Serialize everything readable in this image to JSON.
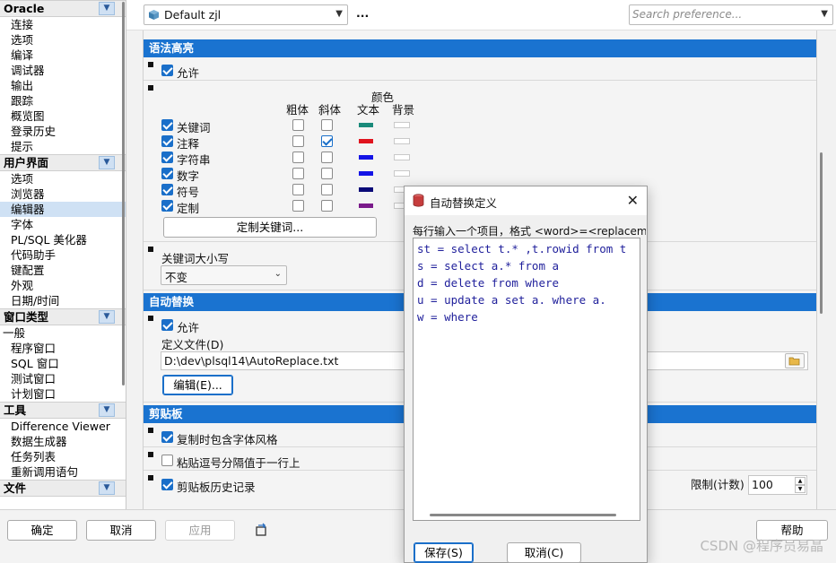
{
  "sidebar": {
    "groups": [
      {
        "header": "Oracle",
        "items": [
          "连接",
          "选项",
          "编译",
          "调试器",
          "输出",
          "跟踪",
          "概览图",
          "登录历史",
          "提示"
        ]
      },
      {
        "header": "用户界面",
        "items": [
          "选项",
          "浏览器",
          "编辑器",
          "字体",
          "PL/SQL 美化器",
          "代码助手",
          "键配置",
          "外观",
          "日期/时间"
        ],
        "selected": 2
      },
      {
        "header": "窗口类型",
        "items": [
          "一般",
          "程序窗口",
          "SQL 窗口",
          "测试窗口",
          "计划窗口"
        ],
        "flush_first": true
      },
      {
        "header": "工具",
        "items": [
          "Difference Viewer",
          "数据生成器",
          "任务列表",
          "重新调用语句"
        ]
      },
      {
        "header": "文件",
        "items": []
      }
    ]
  },
  "topbar": {
    "profile_value": "Default zjl",
    "more_label": "...",
    "search_placeholder": "Search preference..."
  },
  "syntax": {
    "header": "语法高亮",
    "enable_label": "允许",
    "col_bold": "粗体",
    "col_italic": "斜体",
    "col_color": "颜色",
    "col_text": "文本",
    "col_bg": "背景",
    "rows": [
      {
        "label": "关键词",
        "color": "#1a8a7a"
      },
      {
        "label": "注释",
        "color": "#e0141e"
      },
      {
        "label": "字符串",
        "color": "#1414e6"
      },
      {
        "label": "数字",
        "color": "#1414e6"
      },
      {
        "label": "符号",
        "color": "#0a0a78"
      },
      {
        "label": "定制",
        "color": "#7a1a8a"
      }
    ],
    "custom_keywords_button": "定制关键词..."
  },
  "keyword_case": {
    "label": "关键词大小写",
    "value": "不变"
  },
  "autoreplace": {
    "header": "自动替换",
    "enable_label": "允许",
    "file_label": "定义文件(D)",
    "file_value": "D:\\dev\\plsql14\\AutoReplace.txt",
    "edit_button": "编辑(E)..."
  },
  "clipboard": {
    "header": "剪贴板",
    "opt1": "复制时包含字体风格",
    "opt2": "粘贴逗号分隔值于一行上",
    "opt3": "剪贴板历史记录",
    "limit_label": "限制(计数)",
    "limit_value": "100"
  },
  "bottom": {
    "ok": "确定",
    "cancel": "取消",
    "apply": "应用",
    "help": "帮助"
  },
  "dialog": {
    "title": "自动替换定义",
    "instruction": "每行输入一个项目，格式 <word>=<replacem",
    "lines": [
      "st = select t.* ,t.rowid from t",
      "s = select a.* from a",
      "d = delete from where",
      "u = update a set a. where a.",
      "w = where"
    ],
    "save": "保存(S)",
    "cancel": "取消(C)"
  },
  "watermark": "CSDN @程序员易晶"
}
